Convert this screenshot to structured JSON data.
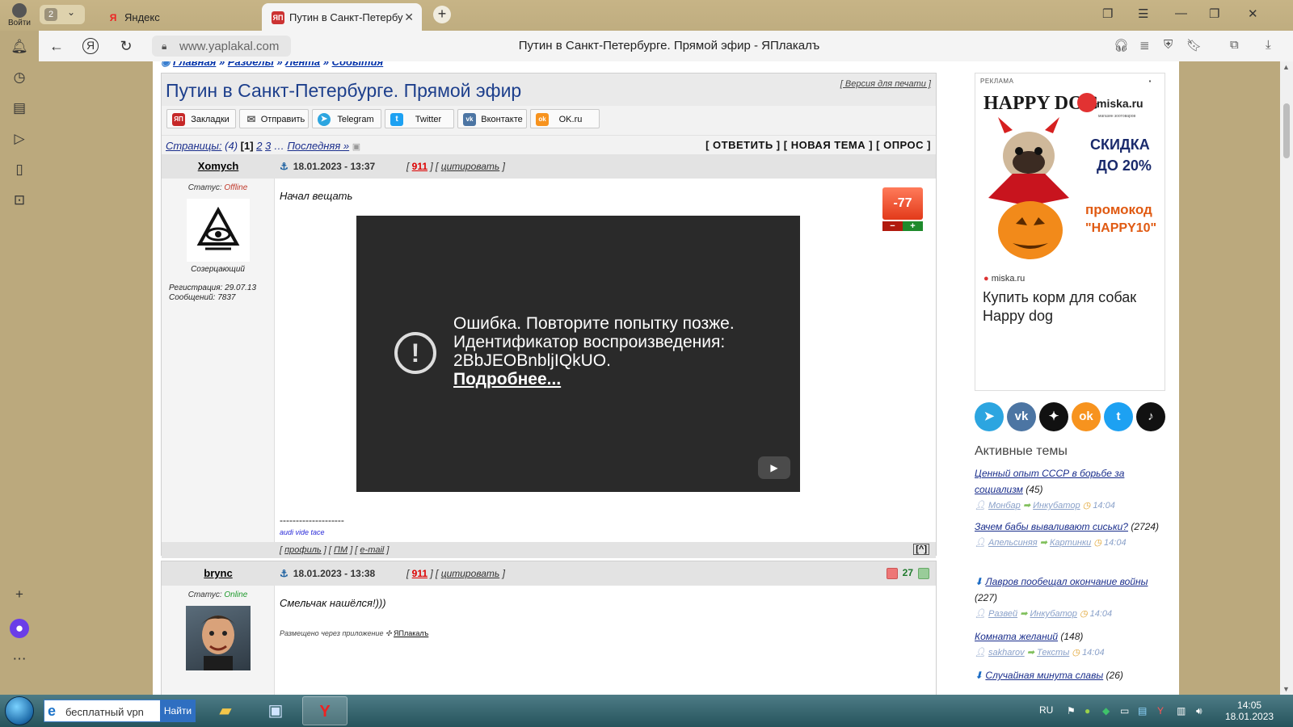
{
  "browser": {
    "login_label": "Войти",
    "tab_count": "2",
    "tabs": [
      {
        "label": "Яндекс",
        "fav": "Я"
      },
      {
        "label": "Путин в Санкт-Петербу",
        "fav": "ЯП"
      }
    ],
    "url": "www.yaplakal.com",
    "page_title": "Путин в Санкт-Петербурге. Прямой эфир - ЯПлакалъ"
  },
  "page": {
    "breadcrumbs": [
      "Главная",
      "Разделы",
      "Лента",
      "События"
    ],
    "topic_title": "Путин в Санкт-Петербурге. Прямой эфир",
    "print_version": "[ Версия для печати ]",
    "share_buttons": [
      {
        "label": "Закладки",
        "icon": "ЯП",
        "color": "#c62828"
      },
      {
        "label": "Отправить",
        "icon": "✉",
        "color": "#777777"
      },
      {
        "label": "Telegram",
        "icon": "➤",
        "color": "#2ca5e0"
      },
      {
        "label": "Twitter",
        "icon": "t",
        "color": "#1da1f2"
      },
      {
        "label": "Вконтакте",
        "icon": "vk",
        "color": "#4c75a3"
      },
      {
        "label": "OK.ru",
        "icon": "ok",
        "color": "#f7931e"
      }
    ],
    "pages_label": "Страницы:",
    "pages_count": "(4)",
    "pages_current": "[1]",
    "pages_links": [
      "2",
      "3"
    ],
    "pages_last": "Последняя »",
    "actions": "[ ОТВЕТИТЬ ] [ НОВАЯ ТЕМА ] [ ОПРОС ]",
    "post1": {
      "user": "Xomych",
      "status_label": "Статус:",
      "status": "Offline",
      "rank": "Созерцающий",
      "registration": "Регистрация: 29.07.13",
      "messages": "Сообщений: 7837",
      "date": "18.01.2023 - 13:37",
      "num": "911",
      "quote": "цитировать",
      "text": "Начал вещать",
      "rating": "-77",
      "signature_line": "--------------------",
      "signature": "audi vide tace",
      "footer_links": [
        "профиль",
        "ПМ",
        "e-mail"
      ],
      "top_link": "[^]"
    },
    "video": {
      "error_line1": "Ошибка. Повторите попытку позже.",
      "error_line2": "Идентификатор воспроизведения:",
      "error_line3": "2BbJEOBnbljIQkUO.",
      "more": "Подробнее..."
    },
    "post2": {
      "user": "brync",
      "status_label": "Статус:",
      "status": "Online",
      "date": "18.01.2023 - 13:38",
      "num": "911",
      "quote": "цитировать",
      "text": "Смельчак нашёлся!)))",
      "rating": "27",
      "from_app": "Размещено через приложение",
      "app_name": "ЯПлакалъ"
    },
    "ad": {
      "label": "РЕКЛАМА",
      "brand1": "HAPPY DOG",
      "brand2": "miska.ru",
      "brand2_sub": "магазин зоотоваров",
      "discount": "СКИДКА ДО 20%",
      "promo1": "промокод",
      "promo2": "\"HAPPY10\"",
      "site": "miska.ru",
      "title": "Купить корм для собак Happy dog"
    },
    "socials": [
      {
        "name": "telegram",
        "glyph": "➤",
        "color": "#2ca5e0"
      },
      {
        "name": "vk",
        "glyph": "vk",
        "color": "#4c75a3"
      },
      {
        "name": "dzen",
        "glyph": "✦",
        "color": "#111111"
      },
      {
        "name": "ok",
        "glyph": "ok",
        "color": "#f7931e"
      },
      {
        "name": "twitter",
        "glyph": "t",
        "color": "#1da1f2"
      },
      {
        "name": "tiktok",
        "glyph": "♪",
        "color": "#111111"
      }
    ],
    "active_topics_title": "Активные темы",
    "active_topics": [
      {
        "title": "Ценный опыт СССР в борьбе за социализм",
        "count": "(45)",
        "author": "Монбар",
        "section": "Инкубатор",
        "time": "14:04"
      },
      {
        "title": "Зачем бабы вываливают сиськи?",
        "count": "(2724)",
        "author": "Апельсиняя",
        "section": "Картинки",
        "time": "14:04"
      },
      {
        "title": "Лавров пообещал окончание войны",
        "count": "(227)",
        "author": "Развей",
        "section": "Инкубатор",
        "time": "14:04"
      },
      {
        "title": "Комната желаний",
        "count": "(148)",
        "author": "sakharov",
        "section": "Тексты",
        "time": "14:04"
      },
      {
        "title": "Случайная минута славы",
        "count": "(26)",
        "author": "",
        "section": "",
        "time": ""
      }
    ]
  },
  "taskbar": {
    "search_text": "бесплатный vpn",
    "search_button": "Найти",
    "lang": "RU",
    "time": "14:05",
    "date": "18.01.2023"
  }
}
